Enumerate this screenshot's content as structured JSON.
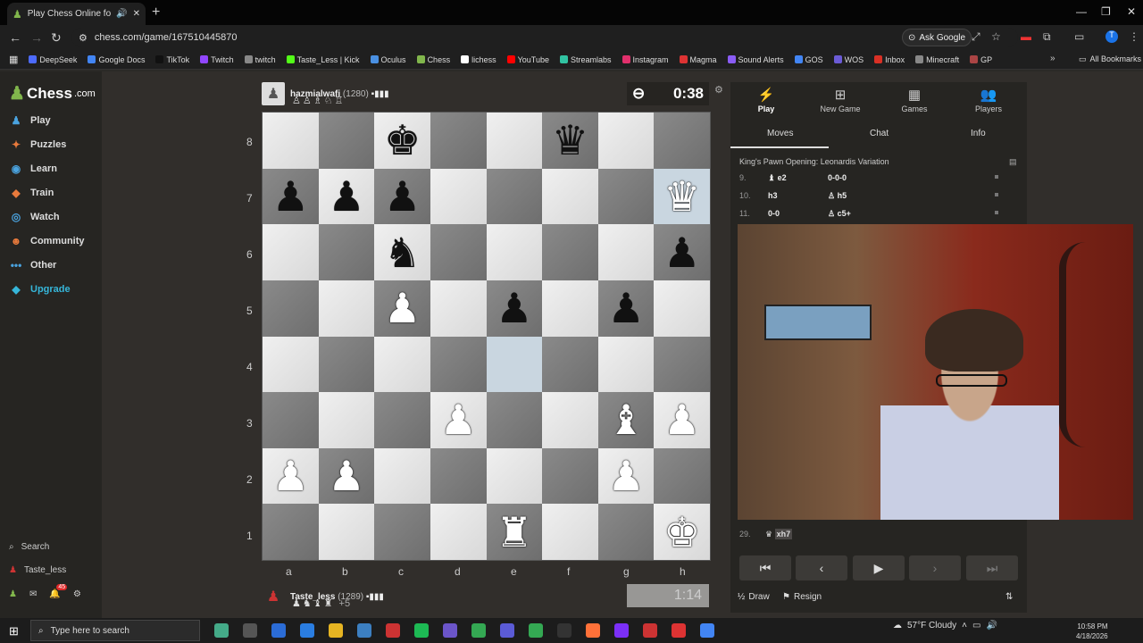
{
  "browser": {
    "tab_title": "Play Chess Online for FREE",
    "url": "chess.com/game/167510445870",
    "ask_google": "Ask Google",
    "bookmarks": [
      {
        "label": "DeepSeek",
        "color": "#4d6bfe"
      },
      {
        "label": "Google Docs",
        "color": "#4285f4"
      },
      {
        "label": "TikTok",
        "color": "#111111"
      },
      {
        "label": "Twitch",
        "color": "#9146ff"
      },
      {
        "label": "twitch",
        "color": "#888888"
      },
      {
        "label": "Taste_Less | Kick",
        "color": "#53fc18"
      },
      {
        "label": "Oculus",
        "color": "#4a90e2"
      },
      {
        "label": "Chess",
        "color": "#81b64c"
      },
      {
        "label": "lichess",
        "color": "#ffffff"
      },
      {
        "label": "YouTube",
        "color": "#ff0000"
      },
      {
        "label": "Streamlabs",
        "color": "#31c3a2"
      },
      {
        "label": "Instagram",
        "color": "#e1306c"
      },
      {
        "label": "Magma",
        "color": "#d33"
      },
      {
        "label": "Sound Alerts",
        "color": "#8a5cf6"
      },
      {
        "label": "GOS",
        "color": "#4285f4"
      },
      {
        "label": "WOS",
        "color": "#6b5bd6"
      },
      {
        "label": "Inbox",
        "color": "#d93025"
      },
      {
        "label": "Minecraft",
        "color": "#888888"
      },
      {
        "label": "GP",
        "color": "#a44"
      }
    ],
    "all_bookmarks": "All Bookmarks"
  },
  "sidebar": {
    "logo": "Chess",
    "logo_suffix": ".com",
    "items": [
      {
        "label": "Play",
        "icon": "board-icon",
        "glyph": "♟"
      },
      {
        "label": "Puzzles",
        "icon": "puzzle-icon",
        "glyph": "✦"
      },
      {
        "label": "Learn",
        "icon": "learn-icon",
        "glyph": "◉"
      },
      {
        "label": "Train",
        "icon": "train-icon",
        "glyph": "◆"
      },
      {
        "label": "Watch",
        "icon": "watch-icon",
        "glyph": "◎"
      },
      {
        "label": "Community",
        "icon": "community-icon",
        "glyph": "☻"
      },
      {
        "label": "Other",
        "icon": "more-icon",
        "glyph": "•••"
      },
      {
        "label": "Upgrade",
        "icon": "diamond-icon",
        "glyph": "◆"
      }
    ],
    "search": "Search",
    "username": "Taste_less",
    "notif_count": "45"
  },
  "game": {
    "opponent": {
      "name": "hazmialwafi",
      "rating": "(1280)",
      "captured": "♙♙♗♘♖",
      "clock": "0:38"
    },
    "player": {
      "name": "Taste_less",
      "rating": "(1289)",
      "captured": "♟♞♝♜",
      "advantage": "+5",
      "clock": "1:14"
    },
    "ranks": [
      "8",
      "7",
      "6",
      "5",
      "4",
      "3",
      "2",
      "1"
    ],
    "files": [
      "a",
      "b",
      "c",
      "d",
      "e",
      "f",
      "g",
      "h"
    ],
    "position": [
      [
        "",
        "",
        "bk",
        "",
        "",
        "bq",
        "",
        ""
      ],
      [
        "bp",
        "bp",
        "bp",
        "",
        "",
        "",
        "",
        "wq"
      ],
      [
        "",
        "",
        "bn",
        "",
        "",
        "",
        "",
        "bp"
      ],
      [
        "",
        "",
        "wp",
        "",
        "bp",
        "",
        "bp",
        ""
      ],
      [
        "",
        "",
        "",
        "",
        "",
        "",
        "",
        ""
      ],
      [
        "",
        "",
        "",
        "wp",
        "",
        "",
        "wb",
        "wp"
      ],
      [
        "wp",
        "wp",
        "",
        "",
        "",
        "",
        "wp",
        ""
      ],
      [
        "",
        "",
        "",
        "",
        "wr",
        "",
        "",
        "wk"
      ]
    ],
    "highlight": [
      "e4",
      "h7"
    ]
  },
  "panel": {
    "tabs": [
      {
        "label": "Play",
        "glyph": "⚡"
      },
      {
        "label": "New Game",
        "glyph": "⊞"
      },
      {
        "label": "Games",
        "glyph": "▦"
      },
      {
        "label": "Players",
        "glyph": "👥"
      }
    ],
    "subtabs": [
      "Moves",
      "Chat",
      "Info"
    ],
    "opening": "King's Pawn Opening: Leonardis Variation",
    "moves": [
      {
        "num": "9.",
        "white": "e2",
        "white_piece": "♝",
        "black": "0-0-0",
        "black_piece": ""
      },
      {
        "num": "10.",
        "white": "h3",
        "white_piece": "",
        "black": "h5",
        "black_piece": "♙"
      },
      {
        "num": "11.",
        "white": "0-0",
        "white_piece": "",
        "black": "c5+",
        "black_piece": "♙"
      }
    ],
    "last_move": {
      "num": "29.",
      "text": "xh7",
      "piece": "♛"
    },
    "draw": "Draw",
    "resign": "Resign"
  },
  "taskbar": {
    "search_placeholder": "Type here to search",
    "weather": "57°F  Cloudy",
    "time": "10:58 PM",
    "date": "4/18/2026"
  }
}
